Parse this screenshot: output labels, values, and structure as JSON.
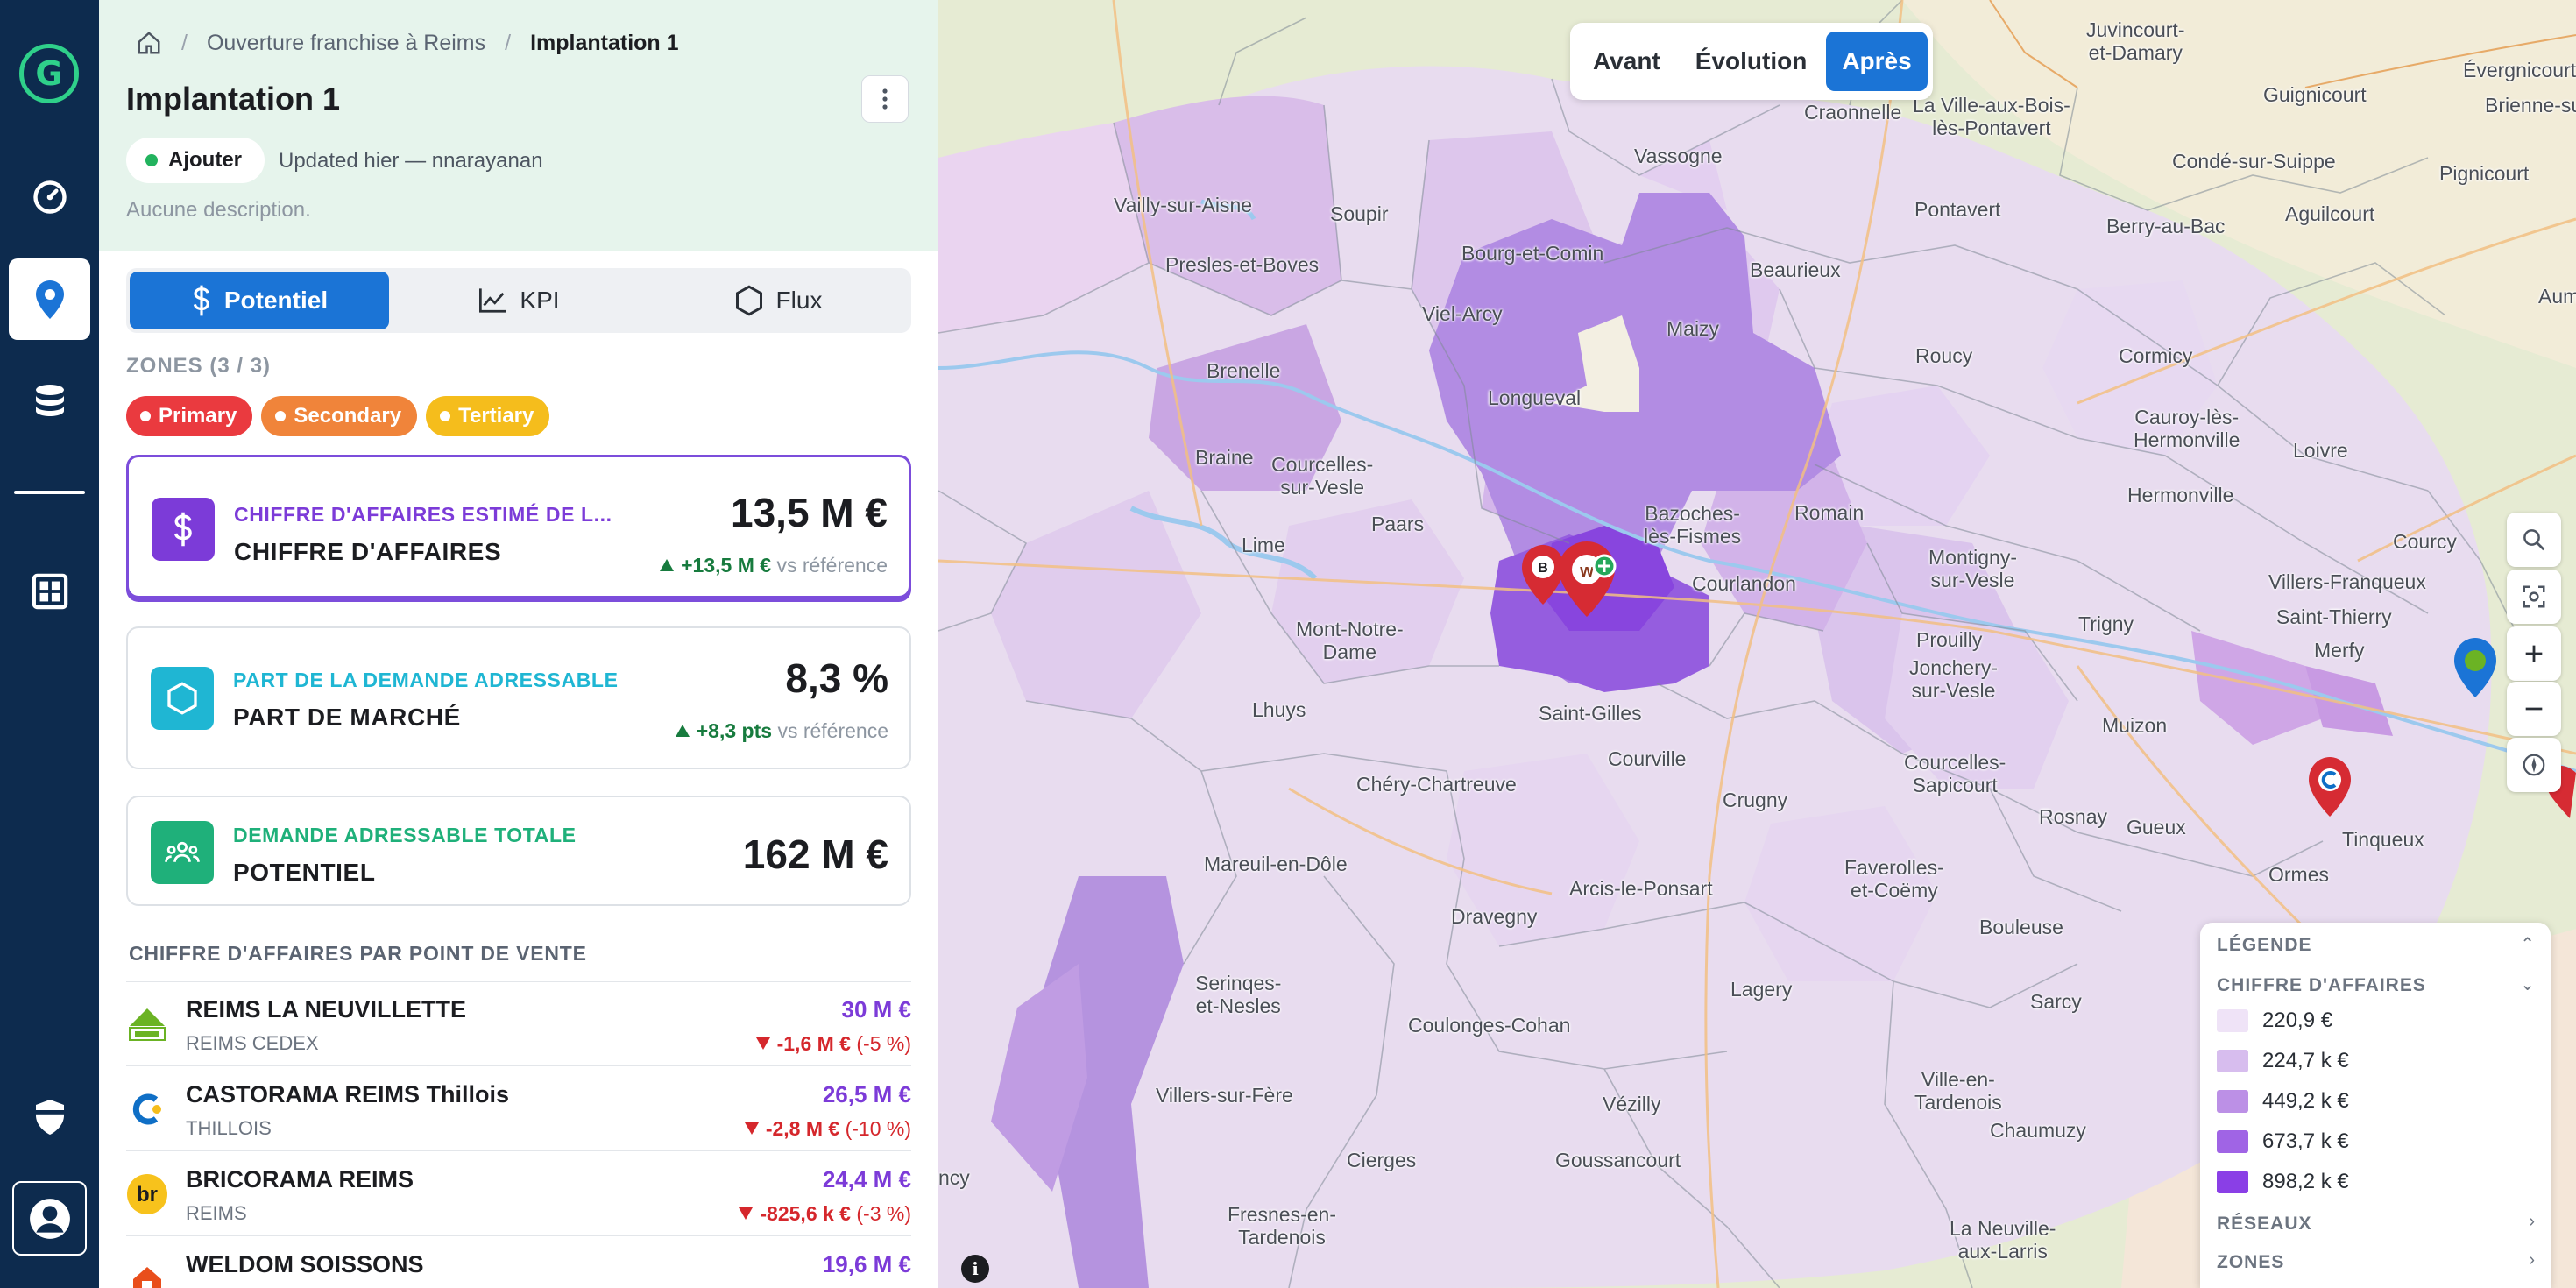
{
  "breadcrumb": {
    "parent": "Ouverture franchise à Reims",
    "current": "Implantation 1"
  },
  "header": {
    "title": "Implantation 1",
    "status_label": "Ajouter",
    "updated": "Updated hier — nnarayanan",
    "description": "Aucune description."
  },
  "tabs": [
    {
      "label": "Potentiel",
      "icon": "dollar-icon",
      "active": true
    },
    {
      "label": "KPI",
      "icon": "line-chart-icon",
      "active": false
    },
    {
      "label": "Flux",
      "icon": "hexagon-icon",
      "active": false
    }
  ],
  "zones": {
    "label": "ZONES (3 / 3)",
    "chips": [
      {
        "label": "Primary",
        "color": "#ea3a3f"
      },
      {
        "label": "Secondary",
        "color": "#f0843a"
      },
      {
        "label": "Tertiary",
        "color": "#f5bd1c"
      }
    ]
  },
  "kpis": [
    {
      "overline": "CHIFFRE D'AFFAIRES ESTIMÉ DE L...",
      "name": "CHIFFRE D'AFFAIRES",
      "value": "13,5 M €",
      "delta": "+13,5 M €",
      "delta_suffix": "vs référence",
      "color": "#7c3bd8",
      "icon": "dollar-icon"
    },
    {
      "overline": "PART DE LA DEMANDE ADRESSABLE",
      "name": "PART DE MARCHÉ",
      "value": "8,3 %",
      "delta": "+8,3 pts",
      "delta_suffix": "vs référence",
      "color": "#1fb6d3",
      "icon": "hexagon-icon"
    },
    {
      "overline": "DEMANDE ADRESSABLE TOTALE",
      "name": "POTENTIEL",
      "value": "162 M €",
      "color": "#1fb07a",
      "icon": "people-icon"
    }
  ],
  "stores": {
    "title": "CHIFFRE D'AFFAIRES PAR POINT DE VENTE",
    "items": [
      {
        "name": "REIMS LA NEUVILLETTE",
        "city": "REIMS CEDEX",
        "value": "30 M €",
        "delta": "-1,6 M €",
        "pct": "(-5 %)",
        "logo": "leroy-merlin-logo"
      },
      {
        "name": "CASTORAMA REIMS Thillois",
        "city": "THILLOIS",
        "value": "26,5 M €",
        "delta": "-2,8 M €",
        "pct": "(-10 %)",
        "logo": "castorama-logo"
      },
      {
        "name": "BRICORAMA REIMS",
        "city": "REIMS",
        "value": "24,4 M €",
        "delta": "-825,6 k €",
        "pct": "(-3 %)",
        "logo": "bricorama-logo"
      },
      {
        "name": "WELDOM SOISSONS",
        "city": "",
        "value": "19,6 M €",
        "delta": "",
        "pct": "",
        "logo": "weldom-logo"
      }
    ]
  },
  "map": {
    "segmented": [
      {
        "label": "Avant",
        "active": false
      },
      {
        "label": "Évolution",
        "active": false
      },
      {
        "label": "Après",
        "active": true
      }
    ],
    "places": [
      "Juvincourt-\net-Damary",
      "Évergnicourt",
      "Craonnelle",
      "La Ville-aux-Bois-\nlès-Pontavert",
      "Guignicourt",
      "Brienne-sur-",
      "Vailly-sur-Aisne",
      "Vassogne",
      "Condé-sur-Suippe",
      "Pignicourt",
      "Soupir",
      "Pontavert",
      "Aguilcourt",
      "Presles-et-Boves",
      "Bourg-et-Comin",
      "Beaurieux",
      "Berry-au-Bac",
      "Viel-Arcy",
      "Aum",
      "Maizy",
      "Brenelle",
      "Roucy",
      "Cormicy",
      "Longueval",
      "Cauroy-lès-\nHermonville",
      "Braine",
      "Courcelles-\nsur-Vesle",
      "Loivre",
      "Paars",
      "Bazoches-\nlès-Fismes",
      "Romain",
      "Hermonville",
      "Lime",
      "Courcy",
      "Courlandon",
      "Montigny-\nsur-Vesle",
      "Villers-Franqueux",
      "Mont-Notre-\nDame",
      "Saint-Thierry",
      "Prouilly",
      "Trigny",
      "Merfy",
      "Jonchery-\nsur-Vesle",
      "Lhuys",
      "Saint-Gilles",
      "Muizon",
      "Courville",
      "Chéry-Chartreuve",
      "Crugny",
      "Courcelles-\nSapicourt",
      "Rosnay",
      "Gueux",
      "Tinqueux",
      "Mareuil-en-Dôle",
      "Arcis-le-Ponsart",
      "Faverolles-\net-Coëmy",
      "Ormes",
      "Dravegny",
      "Serinqes-\net-Nesles",
      "Bouleuse",
      "Lagery",
      "Sarcy",
      "Coulonges-Cohan",
      "Villers-sur-Fère",
      "Ville-en-\nTardenois",
      "Vézilly",
      "Chaumuzy",
      "Cierges",
      "Goussancourt",
      "Fresnes-en-\nTardenois",
      "La Neuville-\naux-Larris",
      "ncy"
    ]
  },
  "legend": {
    "title": "LÉGENDE",
    "section": "CHIFFRE D'AFFAIRES",
    "items": [
      {
        "label": "220,9 €",
        "color": "#efe3f7"
      },
      {
        "label": "224,7 k €",
        "color": "#d7bdee"
      },
      {
        "label": "449,2 k €",
        "color": "#bc90e6"
      },
      {
        "label": "673,7 k €",
        "color": "#a064e5"
      },
      {
        "label": "898,2 k €",
        "color": "#8a3fe6"
      }
    ],
    "networks": "RÉSEAUX",
    "zones": "ZONES"
  }
}
